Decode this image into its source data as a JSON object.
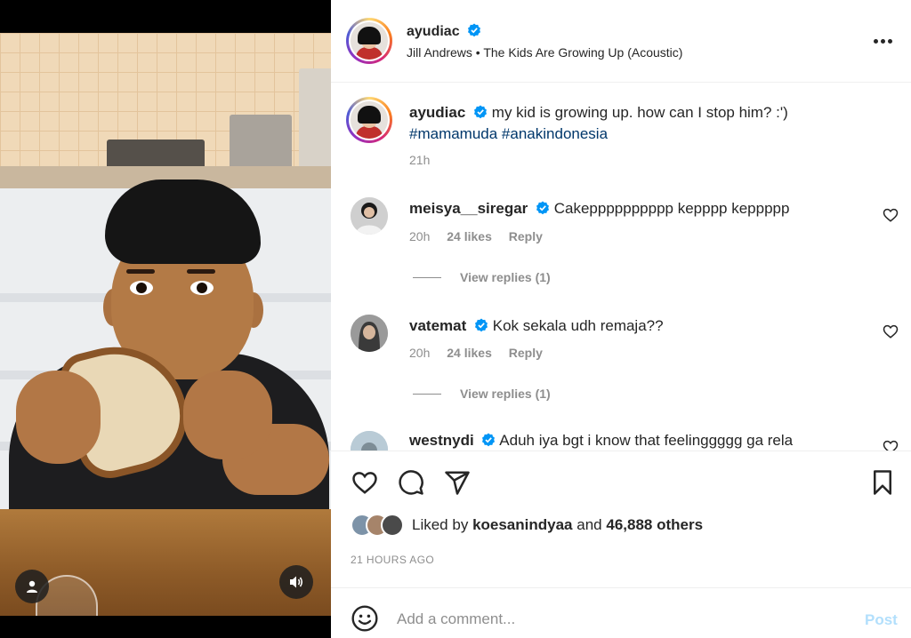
{
  "post": {
    "username": "ayudiac",
    "audio": "Jill Andrews • The Kids Are Growing Up (Acoustic)",
    "caption_text": "my kid is growing up. how can I stop him? :')",
    "hashtags": "#mamamuda #anakindonesia",
    "caption_time": "21h"
  },
  "comments": [
    {
      "username": "meisya__siregar",
      "text": "Cakepppppppppp kepppp keppppp",
      "time": "20h",
      "likes": "24 likes",
      "reply": "Reply",
      "view_replies": "View replies (1)"
    },
    {
      "username": "vatemat",
      "text": "Kok sekala udh remaja??",
      "time": "20h",
      "likes": "24 likes",
      "reply": "Reply",
      "view_replies": "View replies (1)"
    },
    {
      "username": "westnydi",
      "text": "Aduh iya bgt i know that feelinggggg ga rela"
    }
  ],
  "likes": {
    "prefix": "Liked by",
    "user": "koesanindyaa",
    "and": "and",
    "others": "46,888 others"
  },
  "timestamp": "21 HOURS AGO",
  "comment_box": {
    "placeholder": "Add a comment...",
    "post_label": "Post"
  },
  "icons": [
    "more-icon",
    "verified-icon",
    "heart-icon",
    "comment-icon",
    "share-icon",
    "bookmark-icon",
    "emoji-icon",
    "user-tag-icon",
    "volume-icon"
  ],
  "colors": {
    "verified": "#0095f6",
    "hashtag": "#00376b",
    "post_disabled": "#b2dffc",
    "secondary_text": "#8e8e8e"
  }
}
